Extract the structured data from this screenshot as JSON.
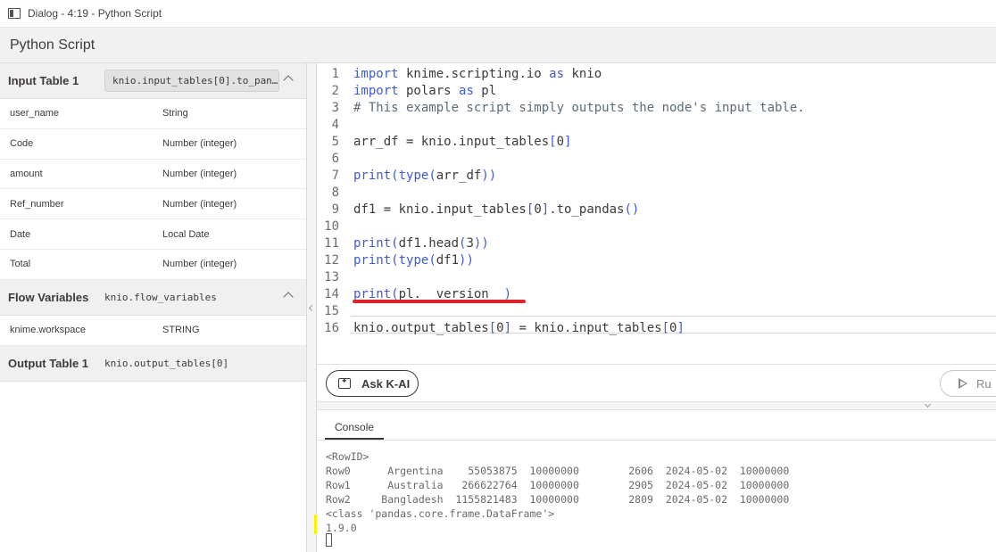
{
  "window": {
    "title": "Dialog - 4:19 - Python Script"
  },
  "header": {
    "title": "Python Script"
  },
  "input_table": {
    "label": "Input Table 1",
    "code": "knio.input_tables[0].to_pan…",
    "columns": [
      {
        "name": "user_name",
        "type": "String"
      },
      {
        "name": "Code",
        "type": "Number (integer)"
      },
      {
        "name": "amount",
        "type": "Number (integer)"
      },
      {
        "name": "Ref_number",
        "type": "Number (integer)"
      },
      {
        "name": "Date",
        "type": "Local Date"
      },
      {
        "name": "Total",
        "type": "Number (integer)"
      }
    ]
  },
  "flow_variables": {
    "label": "Flow Variables",
    "code": "knio.flow_variables",
    "items": [
      {
        "name": "knime.workspace",
        "type": "STRING"
      }
    ]
  },
  "output_table": {
    "label": "Output Table 1",
    "code": "knio.output_tables[0]"
  },
  "editor": {
    "lines": [
      {
        "n": "1",
        "parts": [
          [
            "kw",
            "import"
          ],
          [
            "",
            " knime.scripting.io "
          ],
          [
            "kw",
            "as"
          ],
          [
            "",
            " knio"
          ]
        ]
      },
      {
        "n": "2",
        "parts": [
          [
            "kw",
            "import"
          ],
          [
            "",
            " polars "
          ],
          [
            "kw",
            "as"
          ],
          [
            "",
            " pl"
          ]
        ]
      },
      {
        "n": "3",
        "parts": [
          [
            "cm",
            "# This example script simply outputs the node's input table."
          ]
        ]
      },
      {
        "n": "4",
        "parts": []
      },
      {
        "n": "5",
        "parts": [
          [
            "",
            "arr_df = knio.input_tables"
          ],
          [
            "kw",
            "["
          ],
          [
            "",
            "0"
          ],
          [
            "kw",
            "]"
          ]
        ]
      },
      {
        "n": "6",
        "parts": []
      },
      {
        "n": "7",
        "parts": [
          [
            "fn",
            "print"
          ],
          [
            "kw",
            "("
          ],
          [
            "fn",
            "type"
          ],
          [
            "kw",
            "("
          ],
          [
            "",
            "arr_df"
          ],
          [
            "kw",
            "))"
          ]
        ]
      },
      {
        "n": "8",
        "parts": []
      },
      {
        "n": "9",
        "parts": [
          [
            "",
            "df1 = knio.input_tables"
          ],
          [
            "kw",
            "["
          ],
          [
            "",
            "0"
          ],
          [
            "kw",
            "]"
          ],
          [
            "",
            ".to_pandas"
          ],
          [
            "kw",
            "()"
          ]
        ]
      },
      {
        "n": "10",
        "parts": []
      },
      {
        "n": "11",
        "parts": [
          [
            "fn",
            "print"
          ],
          [
            "kw",
            "("
          ],
          [
            "",
            "df1.head"
          ],
          [
            "kw",
            "("
          ],
          [
            "",
            "3"
          ],
          [
            "kw",
            "))"
          ]
        ]
      },
      {
        "n": "12",
        "parts": [
          [
            "fn",
            "print"
          ],
          [
            "kw",
            "("
          ],
          [
            "fn",
            "type"
          ],
          [
            "kw",
            "("
          ],
          [
            "",
            "df1"
          ],
          [
            "kw",
            "))"
          ]
        ]
      },
      {
        "n": "13",
        "parts": []
      },
      {
        "n": "14",
        "parts": [
          [
            "fn",
            "print"
          ],
          [
            "kw",
            "("
          ],
          [
            "",
            "pl.__version__"
          ],
          [
            "kw",
            ")"
          ]
        ]
      },
      {
        "n": "15",
        "parts": []
      },
      {
        "n": "16",
        "parts": [
          [
            "",
            "knio.output_tables"
          ],
          [
            "kw",
            "["
          ],
          [
            "",
            "0"
          ],
          [
            "kw",
            "]"
          ],
          [
            "",
            " = knio.input_tables"
          ],
          [
            "kw",
            "["
          ],
          [
            "",
            "0"
          ],
          [
            "kw",
            "]"
          ]
        ]
      }
    ]
  },
  "toolbar": {
    "ask_label": "Ask K-AI",
    "run_label": "Ru"
  },
  "console": {
    "tab_label": "Console",
    "output": "<RowID>\nRow0      Argentina    55053875  10000000        2606  2024-05-02  10000000\nRow1      Australia   266622764  10000000        2905  2024-05-02  10000000\nRow2     Bangladesh  1155821483  10000000        2809  2024-05-02  10000000\n<class 'pandas.core.frame.DataFrame'>\n1.9.0"
  },
  "colors": {
    "keyword": "#3f5bd6",
    "highlight": "#fff200",
    "underline": "#d8262a"
  }
}
